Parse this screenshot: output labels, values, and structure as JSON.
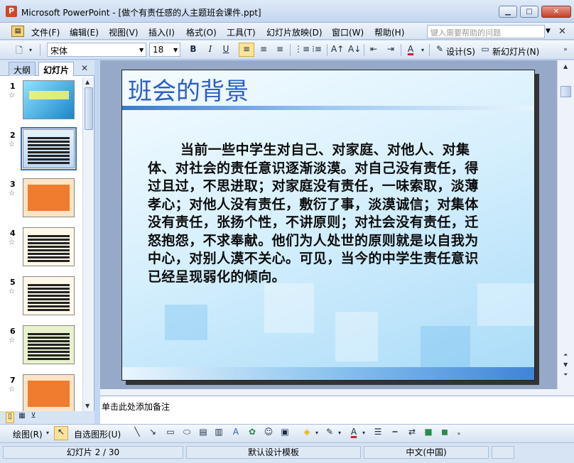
{
  "window": {
    "title": "Microsoft PowerPoint - [做个有责任感的人主题班会课件.ppt]"
  },
  "menu": {
    "items": [
      "文件(F)",
      "编辑(E)",
      "视图(V)",
      "插入(I)",
      "格式(O)",
      "工具(T)",
      "幻灯片放映(D)",
      "窗口(W)",
      "帮助(H)"
    ],
    "help_placeholder": "键入需要帮助的问题"
  },
  "toolbar": {
    "font_name": "宋体",
    "font_size": "18",
    "design_label": "设计(S)",
    "new_slide_label": "新幻灯片(N)"
  },
  "pane": {
    "tabs": [
      "大纲",
      "幻灯片"
    ],
    "thumbnails": [
      {
        "num": "1",
        "style": "cyan"
      },
      {
        "num": "2",
        "style": "blue",
        "selected": true
      },
      {
        "num": "3",
        "style": "orange"
      },
      {
        "num": "4",
        "style": "cream"
      },
      {
        "num": "5",
        "style": "cream"
      },
      {
        "num": "6",
        "style": "green"
      },
      {
        "num": "7",
        "style": "orange"
      }
    ]
  },
  "slide": {
    "title": "班会的背景",
    "body": "当前一些中学生对自己、对家庭、对他人、对集体、对社会的责任意识逐渐淡漠。对自己没有责任，得过且过，不思进取；对家庭没有责任，一味索取，淡薄孝心；对他人没有责任，敷衍了事，淡漠诚信；对集体没有责任，张扬个性，不讲原则；对社会没有责任，迁怒抱怨，不求奉献。他们为人处世的原则就是以自我为中心，对别人漠不关心。可见，当今的中学生责任意识已经呈现弱化的倾向。"
  },
  "notes": {
    "placeholder": "单击此处添加备注"
  },
  "drawing": {
    "draw_label": "绘图(R)",
    "autoshape_label": "自选图形(U)"
  },
  "status": {
    "slide_indicator": "幻灯片 2 / 30",
    "design_template": "默认设计模板",
    "language": "中文(中国)"
  },
  "colors": {
    "accent": "#2b5fc4",
    "title_bar": "#c4d6ee"
  }
}
